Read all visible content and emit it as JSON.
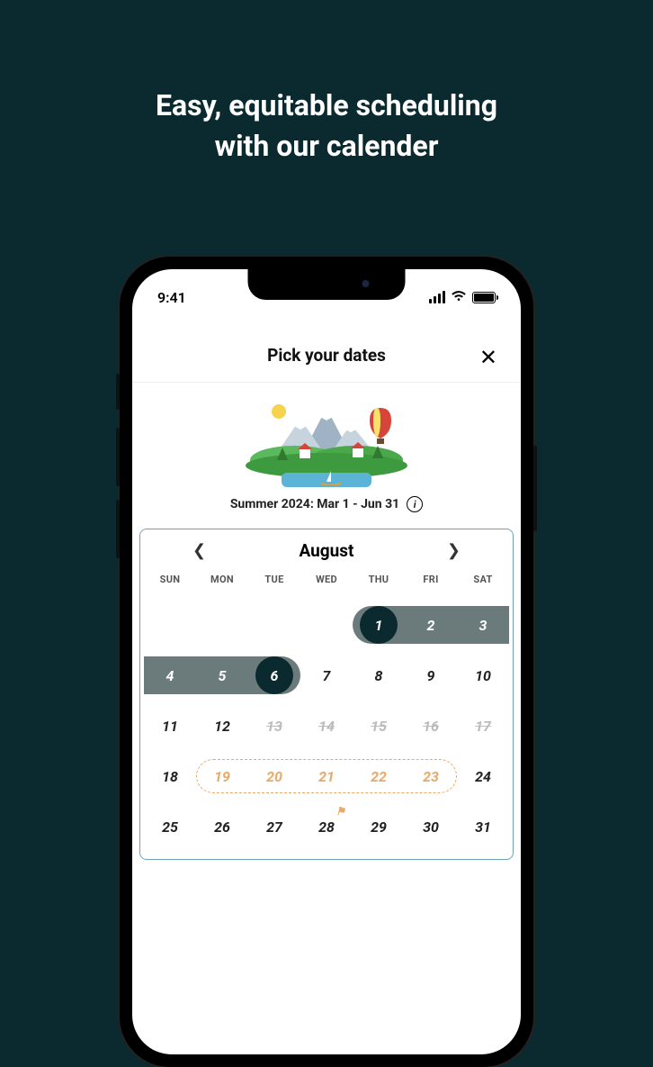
{
  "headline_line1": "Easy, equitable scheduling",
  "headline_line2": "with our calender",
  "status": {
    "time": "9:41"
  },
  "header": {
    "title": "Pick your dates"
  },
  "season": {
    "text": "Summer 2024: Mar 1 - Jun 31"
  },
  "calendar": {
    "month": "August",
    "dow": [
      "SUN",
      "MON",
      "TUE",
      "WED",
      "THU",
      "FRI",
      "SAT"
    ],
    "rows": [
      {
        "selection": "start",
        "cells": [
          {
            "label": "",
            "type": "blank"
          },
          {
            "label": "",
            "type": "blank"
          },
          {
            "label": "",
            "type": "blank"
          },
          {
            "label": "",
            "type": "blank"
          },
          {
            "label": "1",
            "type": "sel-start"
          },
          {
            "label": "2",
            "type": "sel-mid"
          },
          {
            "label": "3",
            "type": "sel-mid"
          }
        ]
      },
      {
        "selection": "end",
        "cells": [
          {
            "label": "4",
            "type": "sel-mid"
          },
          {
            "label": "5",
            "type": "sel-mid"
          },
          {
            "label": "6",
            "type": "sel-end"
          },
          {
            "label": "7",
            "type": "normal"
          },
          {
            "label": "8",
            "type": "normal"
          },
          {
            "label": "9",
            "type": "normal"
          },
          {
            "label": "10",
            "type": "normal"
          }
        ]
      },
      {
        "cells": [
          {
            "label": "11",
            "type": "normal"
          },
          {
            "label": "12",
            "type": "normal"
          },
          {
            "label": "13",
            "type": "struck"
          },
          {
            "label": "14",
            "type": "struck"
          },
          {
            "label": "15",
            "type": "struck"
          },
          {
            "label": "16",
            "type": "struck"
          },
          {
            "label": "17",
            "type": "struck"
          }
        ]
      },
      {
        "dashed": true,
        "cells": [
          {
            "label": "18",
            "type": "normal"
          },
          {
            "label": "19",
            "type": "warm"
          },
          {
            "label": "20",
            "type": "warm"
          },
          {
            "label": "21",
            "type": "warm"
          },
          {
            "label": "22",
            "type": "warm"
          },
          {
            "label": "23",
            "type": "warm"
          },
          {
            "label": "24",
            "type": "normal"
          }
        ]
      },
      {
        "cells": [
          {
            "label": "25",
            "type": "normal"
          },
          {
            "label": "26",
            "type": "normal"
          },
          {
            "label": "27",
            "type": "normal"
          },
          {
            "label": "28",
            "type": "normal",
            "flag": true
          },
          {
            "label": "29",
            "type": "normal"
          },
          {
            "label": "30",
            "type": "normal"
          },
          {
            "label": "31",
            "type": "normal"
          }
        ]
      }
    ]
  }
}
